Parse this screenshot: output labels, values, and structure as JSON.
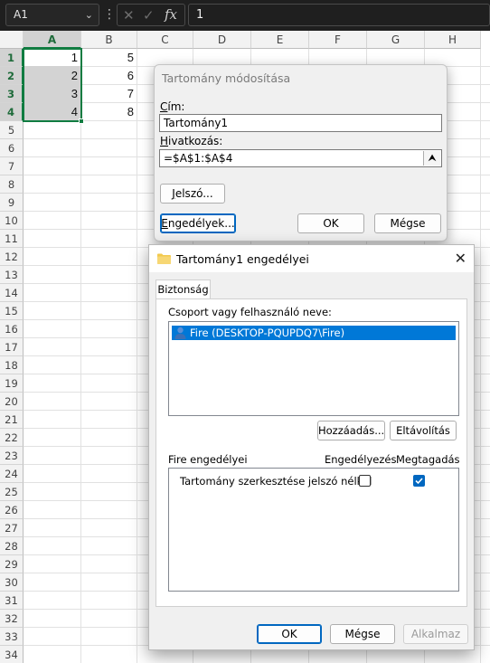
{
  "formula_bar": {
    "name_box": "A1",
    "formula_value": "1",
    "cancel_symbol": "✕",
    "enter_symbol": "✓",
    "fx_symbol": "fx"
  },
  "sheet": {
    "columns": [
      "A",
      "B",
      "C",
      "D",
      "E",
      "F",
      "G",
      "H"
    ],
    "rows": [
      "1",
      "2",
      "3",
      "4",
      "5",
      "6",
      "7",
      "8",
      "9",
      "10",
      "11",
      "12",
      "13",
      "14",
      "15",
      "16",
      "17",
      "18",
      "19",
      "20",
      "21",
      "22",
      "23",
      "24",
      "25",
      "26",
      "27",
      "28",
      "29",
      "30",
      "31",
      "32",
      "33",
      "34"
    ],
    "cells": {
      "A1": "1",
      "A2": "2",
      "A3": "3",
      "A4": "4",
      "B1": "5",
      "B2": "6",
      "B3": "7",
      "B4": "8"
    }
  },
  "range_dialog": {
    "title": "Tartomány módosítása",
    "title_label": "Cím:",
    "title_value": "Tartomány1",
    "ref_label": "Hivatkozás:",
    "ref_value": "=$A$1:$A$4",
    "password_button": "Jelszó...",
    "permissions_button": "Engedélyek...",
    "ok_button": "OK",
    "cancel_button": "Mégse"
  },
  "permissions_dialog": {
    "title": "Tartomány1 engedélyei",
    "tab": "Biztonság",
    "group_label": "Csoport vagy felhasználó neve:",
    "users": [
      "Fire (DESKTOP-PQUPDQ7\\Fire)"
    ],
    "add_button": "Hozzáadás...",
    "remove_button": "Eltávolítás",
    "perm_header": "Fire engedélyei",
    "allow_header": "Engedélyezés",
    "deny_header": "Megtagadás",
    "permission_rows": [
      {
        "label": "Tartomány szerkesztése jelszó nélkül",
        "allow": false,
        "deny": true
      }
    ],
    "ok_button": "OK",
    "cancel_button": "Mégse",
    "apply_button": "Alkalmaz"
  },
  "colors": {
    "accent_green": "#107c41",
    "dialog_blue": "#0067c0",
    "selection_blue": "#0078d7"
  }
}
